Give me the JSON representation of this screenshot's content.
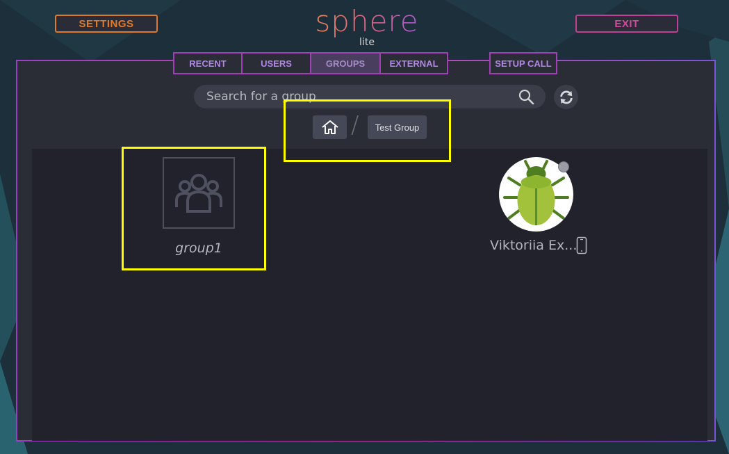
{
  "header": {
    "settings_label": "SETTINGS",
    "exit_label": "EXIT",
    "logo_text": "sphere",
    "logo_subtext": "lite"
  },
  "tabs": [
    {
      "label": "RECENT",
      "active": false
    },
    {
      "label": "USERS",
      "active": false
    },
    {
      "label": "GROUPS",
      "active": true
    },
    {
      "label": "EXTERNAL",
      "active": false
    }
  ],
  "setup_call_label": "SETUP CALL",
  "search": {
    "placeholder": "Search for a group",
    "value": ""
  },
  "breadcrumb": {
    "home_icon": "home-icon",
    "separator": "/",
    "current": "Test Group"
  },
  "groups": [
    {
      "name": "group1",
      "icon": "users-group-icon"
    }
  ],
  "contacts": [
    {
      "name": "Viktoriia Ex...",
      "avatar": "green-bug-avatar",
      "status": "offline",
      "device_icon": "mobile-phone-icon"
    }
  ],
  "colors": {
    "settings": "#e07a26",
    "exit": "#c33e95",
    "tab_border": "#a23fb6",
    "highlight": "#ffff00"
  }
}
